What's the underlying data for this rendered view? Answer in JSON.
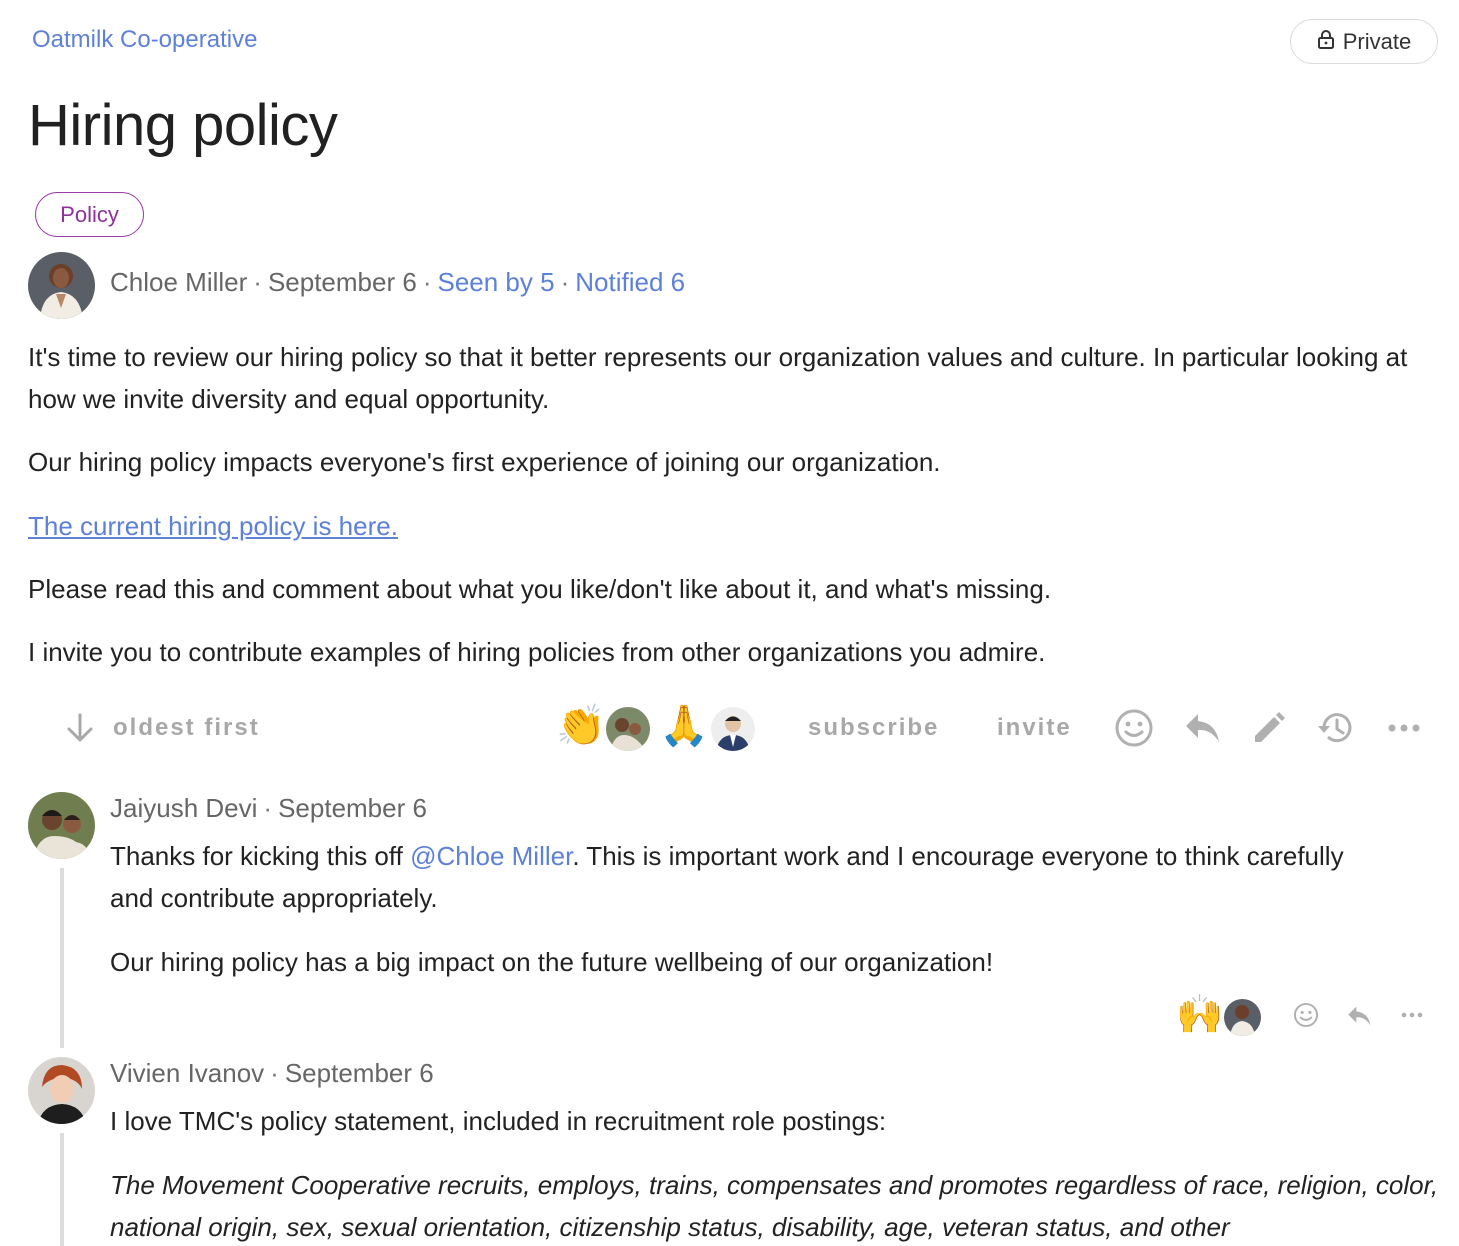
{
  "header": {
    "group_name": "Oatmilk Co-operative",
    "privacy_label": "Private",
    "title": "Hiring policy",
    "tag": "Policy"
  },
  "post": {
    "author": "Chloe Miller",
    "date": "September 6",
    "seen_by": "Seen by 5",
    "notified": "Notified 6",
    "paragraph_1": "It's time to review our hiring policy so that it better represents our organization values and culture. In particular looking at how we invite diversity and equal opportunity.",
    "paragraph_2": "Our hiring policy impacts everyone's first experience of joining our organization.",
    "link_text": "The current hiring policy is here.",
    "paragraph_3": "Please read this and comment about what you like/don't like about it, and what's missing.",
    "paragraph_4": "I invite you to contribute examples of hiring policies from other organizations you admire."
  },
  "toolbar": {
    "sort_label": "oldest first",
    "subscribe_label": "subscribe",
    "invite_label": "invite",
    "reactions": [
      "👏",
      "🙏"
    ]
  },
  "comments": [
    {
      "author": "Jaiyush Devi",
      "date": "September 6",
      "text_before_mention": "Thanks for kicking this off ",
      "mention": "@Chloe Miller",
      "text_after_mention": ". This is important work and I encourage everyone to think carefully and contribute appropriately.",
      "paragraph_2": "Our hiring policy has a big impact on the future wellbeing of our organization!",
      "reaction": "🙌"
    },
    {
      "author": "Vivien Ivanov",
      "date": "September 6",
      "paragraph_1": "I love TMC's policy statement, included in recruitment role postings:",
      "quote": "The Movement Cooperative recruits, employs, trains, compensates and promotes regardless of race, religion, color, national origin, sex, sexual orientation, citizenship status, disability, age, veteran status, and other"
    }
  ],
  "colors": {
    "link": "#5d80d8",
    "tag": "#8e3299",
    "muted": "#a8a8a8"
  },
  "icons": [
    "lock-icon",
    "arrow-down-icon",
    "emoji-icon",
    "reply-icon",
    "edit-icon",
    "history-icon",
    "more-icon"
  ]
}
